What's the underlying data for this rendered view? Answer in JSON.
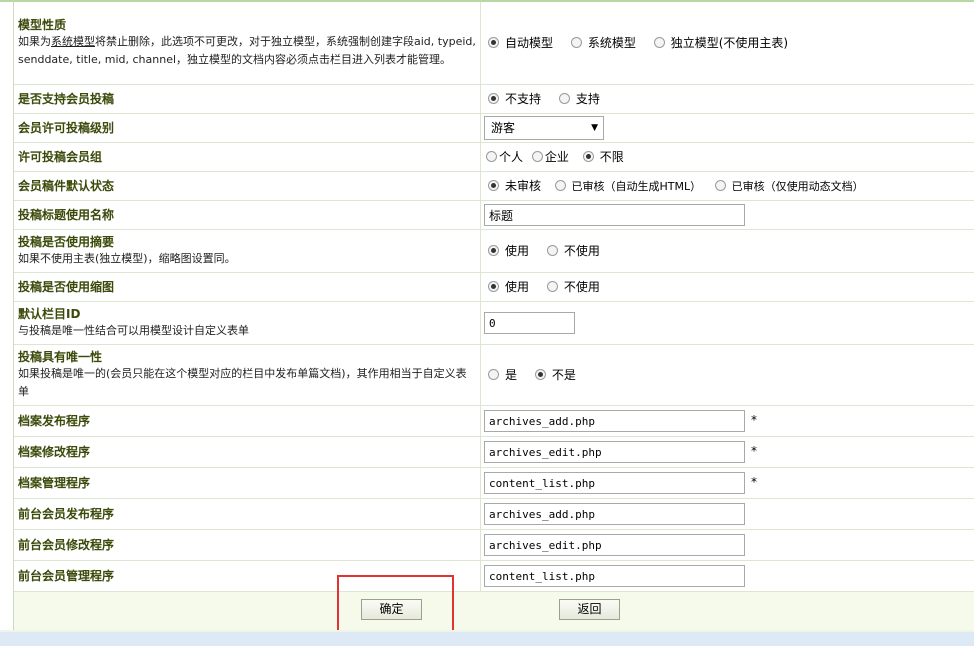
{
  "rows": {
    "model_type": {
      "label": "模型性质",
      "desc_pre": "如果为",
      "desc_link": "系统模型",
      "desc_post": "将禁止删除，此选项不可更改，对于独立模型，系统强制创建字段aid, typeid, senddate, title, mid, channel，独立模型的文档内容必须点击栏目进入列表才能管理。",
      "options": [
        "自动模型",
        "系统模型",
        "独立模型(不使用主表)"
      ],
      "selected": 0
    },
    "member_submit": {
      "label": "是否支持会员投稿",
      "options": [
        "不支持",
        "支持"
      ],
      "selected": 0
    },
    "submit_level": {
      "label": "会员许可投稿级别",
      "value": "游客"
    },
    "submit_group": {
      "label": "许可投稿会员组",
      "options": [
        "个人",
        "企业",
        "不限"
      ],
      "selected": 2
    },
    "default_status": {
      "label": "会员稿件默认状态",
      "options": [
        "未审核",
        "已审核（自动生成HTML）",
        "已审核（仅使用动态文档）"
      ],
      "selected": 0
    },
    "title_name": {
      "label": "投稿标题使用名称",
      "value": "标题"
    },
    "use_summary": {
      "label": "投稿是否使用摘要",
      "desc": "如果不使用主表(独立模型)，缩略图设置同。",
      "options": [
        "使用",
        "不使用"
      ],
      "selected": 0
    },
    "use_thumb": {
      "label": "投稿是否使用缩图",
      "options": [
        "使用",
        "不使用"
      ],
      "selected": 0
    },
    "default_col": {
      "label": "默认栏目ID",
      "desc": "与投稿是唯一性结合可以用模型设计自定义表单",
      "value": "0"
    },
    "unique": {
      "label": "投稿具有唯一性",
      "desc": "如果投稿是唯一的(会员只能在这个模型对应的栏目中发布单篇文档)，其作用相当于自定义表单",
      "options": [
        "是",
        "不是"
      ],
      "selected": 1
    },
    "add_prog": {
      "label": "档案发布程序",
      "value": "archives_add.php",
      "required": "*"
    },
    "edit_prog": {
      "label": "档案修改程序",
      "value": "archives_edit.php",
      "required": "*"
    },
    "manage_prog": {
      "label": "档案管理程序",
      "value": "content_list.php",
      "required": "*"
    },
    "m_add_prog": {
      "label": "前台会员发布程序",
      "value": "archives_add.php"
    },
    "m_edit_prog": {
      "label": "前台会员修改程序",
      "value": "archives_edit.php"
    },
    "m_manage_prog": {
      "label": "前台会员管理程序",
      "value": "content_list.php"
    }
  },
  "buttons": {
    "ok": "确定",
    "back": "返回"
  },
  "colors": {
    "label": "#3b4a0a",
    "footer_bg": "#f6faeb",
    "highlight": "#e23232"
  }
}
